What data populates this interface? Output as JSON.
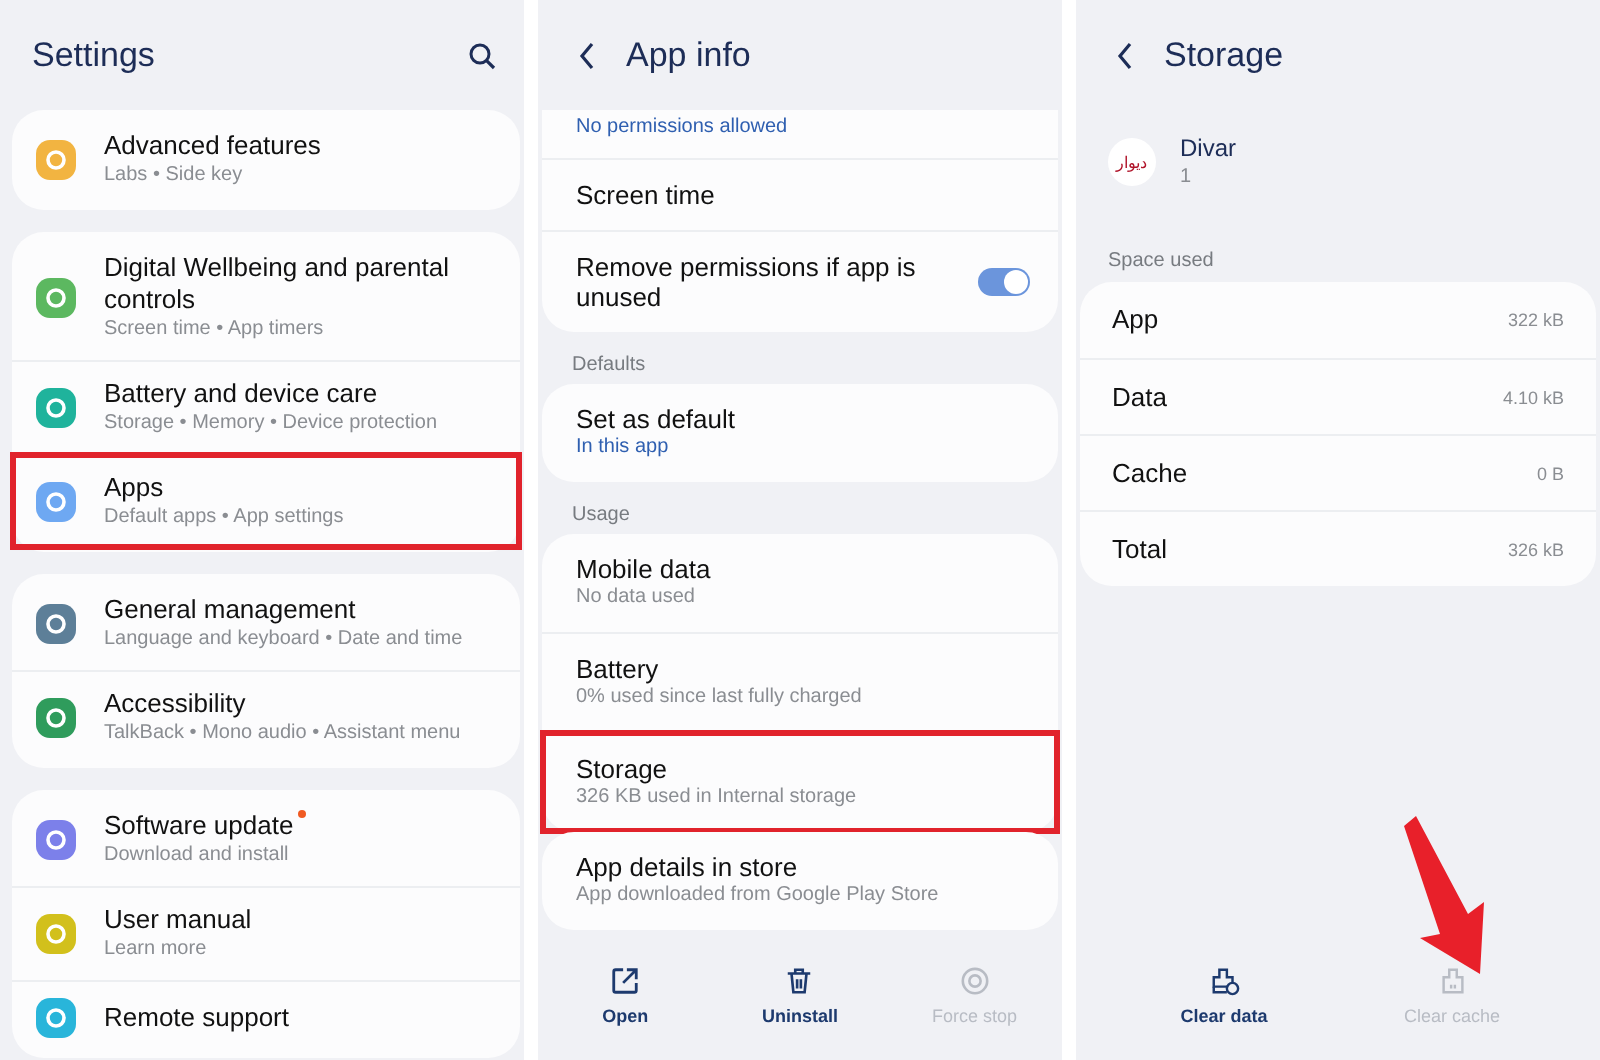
{
  "settings": {
    "title": "Settings",
    "groups": [
      {
        "items": [
          {
            "title": "Advanced features",
            "subtitle": "Labs  •  Side key",
            "color": "#f2b441",
            "highlighted": false,
            "badge": false
          }
        ]
      },
      {
        "items": [
          {
            "title": "Digital Wellbeing and parental controls",
            "subtitle": "Screen time  •  App timers",
            "color": "#5cb860",
            "highlighted": false,
            "badge": false
          },
          {
            "title": "Battery and device care",
            "subtitle": "Storage  •  Memory  •  Device protection",
            "color": "#1fb39c",
            "highlighted": false,
            "badge": false
          },
          {
            "title": "Apps",
            "subtitle": "Default apps  •  App settings",
            "color": "#6ea8f2",
            "highlighted": true,
            "badge": false
          }
        ]
      },
      {
        "items": [
          {
            "title": "General management",
            "subtitle": "Language and keyboard  •  Date and time",
            "color": "#5d7f98",
            "highlighted": false,
            "badge": false
          },
          {
            "title": "Accessibility",
            "subtitle": "TalkBack  •  Mono audio  •  Assistant menu",
            "color": "#2f9c5c",
            "highlighted": false,
            "badge": false
          }
        ]
      },
      {
        "items": [
          {
            "title": "Software update",
            "subtitle": "Download and install",
            "color": "#7c80ea",
            "highlighted": false,
            "badge": true
          },
          {
            "title": "User manual",
            "subtitle": "Learn more",
            "color": "#d2c01c",
            "highlighted": false,
            "badge": false
          },
          {
            "title": "Remote support",
            "color": "#29b5da",
            "highlighted": false,
            "badge": false
          }
        ]
      }
    ]
  },
  "app_info": {
    "title": "App info",
    "groups": [
      {
        "items": [
          {
            "kind": "text",
            "subtitle": "No permissions allowed",
            "accent": true,
            "highlighted": false
          },
          {
            "kind": "text",
            "title": "Screen time",
            "highlighted": false
          },
          {
            "kind": "toggle",
            "title": "Remove permissions if app is unused",
            "on": true,
            "highlighted": false
          }
        ]
      },
      {
        "header": "Defaults",
        "items": [
          {
            "kind": "text",
            "title": "Set as default",
            "subtitle": "In this app",
            "accent": true,
            "highlighted": false
          }
        ]
      },
      {
        "header": "Usage",
        "items": [
          {
            "kind": "text",
            "title": "Mobile data",
            "subtitle": "No data used",
            "accent": false,
            "highlighted": false
          },
          {
            "kind": "text",
            "title": "Battery",
            "subtitle": "0% used since last fully charged",
            "accent": false,
            "highlighted": false
          },
          {
            "kind": "text",
            "title": "Storage",
            "subtitle": "326 KB used in Internal storage",
            "accent": false,
            "highlighted": true
          }
        ]
      },
      {
        "items": [
          {
            "kind": "text",
            "title": "App details in store",
            "subtitle": "App downloaded from Google Play Store",
            "accent": false,
            "highlighted": false
          }
        ]
      }
    ],
    "actions": [
      {
        "kind": "open",
        "label": "Open",
        "disabled": false
      },
      {
        "kind": "uninstall",
        "label": "Uninstall",
        "disabled": false
      },
      {
        "kind": "stop",
        "label": "Force stop",
        "disabled": true
      }
    ]
  },
  "storage": {
    "title": "Storage",
    "app": {
      "name": "Divar",
      "logo_text": "دیوار",
      "version": "1"
    },
    "section": "Space used",
    "rows": [
      {
        "label": "App",
        "value": "322 kB"
      },
      {
        "label": "Data",
        "value": "4.10 kB"
      },
      {
        "label": "Cache",
        "value": "0 B"
      },
      {
        "label": "Total",
        "value": "326 kB"
      }
    ],
    "actions": [
      {
        "kind": "clear_data",
        "label": "Clear data",
        "disabled": false
      },
      {
        "kind": "clear_cache",
        "label": "Clear cache",
        "disabled": true
      }
    ],
    "pointer_arrow": true
  }
}
